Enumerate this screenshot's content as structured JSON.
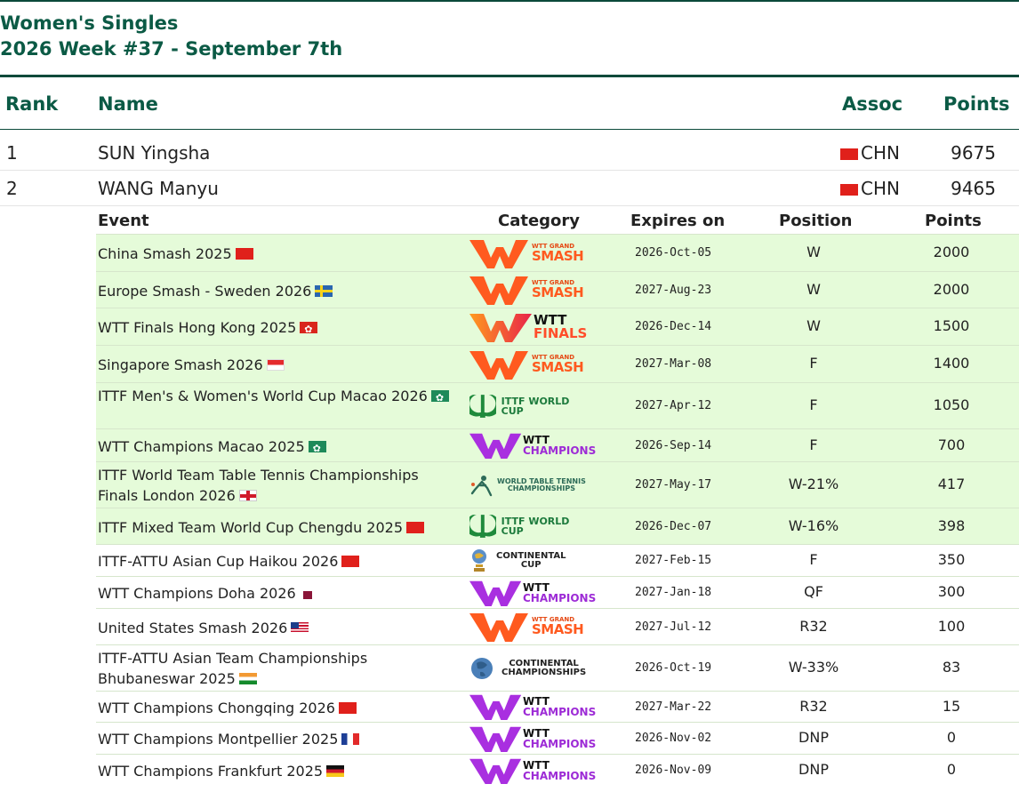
{
  "header": {
    "title": "Women's Singles",
    "subtitle": "2026 Week #37 - September 7th"
  },
  "columns": {
    "rank": "Rank",
    "name": "Name",
    "assoc": "Assoc",
    "points": "Points"
  },
  "players": [
    {
      "rank": "1",
      "name": "SUN Yingsha",
      "assoc": "CHN",
      "points": "9675"
    },
    {
      "rank": "2",
      "name": "WANG Manyu",
      "assoc": "CHN",
      "points": "9465"
    }
  ],
  "event_columns": {
    "event": "Event",
    "category": "Category",
    "expires": "Expires on",
    "position": "Position",
    "points": "Points"
  },
  "events": [
    {
      "name": "China Smash 2025",
      "flag": "cn",
      "category": "wtt-grand-smash",
      "expires": "2026-Oct-05",
      "position": "W",
      "points": "2000",
      "highlight": true
    },
    {
      "name": "Europe Smash - Sweden 2026",
      "flag": "se",
      "category": "wtt-grand-smash",
      "expires": "2027-Aug-23",
      "position": "W",
      "points": "2000",
      "highlight": true
    },
    {
      "name": "WTT Finals Hong Kong 2025",
      "flag": "hk",
      "category": "wtt-finals",
      "expires": "2026-Dec-14",
      "position": "W",
      "points": "1500",
      "highlight": true
    },
    {
      "name": "Singapore Smash 2026",
      "flag": "sg",
      "category": "wtt-grand-smash",
      "expires": "2027-Mar-08",
      "position": "F",
      "points": "1400",
      "highlight": true
    },
    {
      "name": "ITTF Men's & Women's World Cup Macao 2026",
      "flag": "mo",
      "category": "ittf-world-cup",
      "expires": "2027-Apr-12",
      "position": "F",
      "points": "1050",
      "highlight": true
    },
    {
      "name": "WTT Champions Macao 2025",
      "flag": "mo",
      "category": "wtt-champions",
      "expires": "2026-Sep-14",
      "position": "F",
      "points": "700",
      "highlight": true
    },
    {
      "name": "ITTF World Team Table Tennis Championships Finals London 2026",
      "flag": "en",
      "category": "world-table-tennis-championships",
      "expires": "2027-May-17",
      "position": "W-21%",
      "points": "417",
      "highlight": true
    },
    {
      "name": "ITTF Mixed Team World Cup Chengdu 2025",
      "flag": "cn",
      "category": "ittf-world-cup",
      "expires": "2026-Dec-07",
      "position": "W-16%",
      "points": "398",
      "highlight": true
    },
    {
      "name": "ITTF-ATTU Asian Cup Haikou 2026",
      "flag": "cn",
      "category": "continental-cup",
      "expires": "2027-Feb-15",
      "position": "F",
      "points": "350",
      "highlight": false
    },
    {
      "name": "WTT Champions Doha 2026",
      "flag": "qa",
      "category": "wtt-champions",
      "expires": "2027-Jan-18",
      "position": "QF",
      "points": "300",
      "highlight": false
    },
    {
      "name": "United States Smash 2026",
      "flag": "us",
      "category": "wtt-grand-smash",
      "expires": "2027-Jul-12",
      "position": "R32",
      "points": "100",
      "highlight": false
    },
    {
      "name": "ITTF-ATTU Asian Team Championships Bhubaneswar 2025",
      "flag": "in",
      "category": "continental-championships",
      "expires": "2026-Oct-19",
      "position": "W-33%",
      "points": "83",
      "highlight": false
    },
    {
      "name": "WTT Champions Chongqing 2026",
      "flag": "cn",
      "category": "wtt-champions",
      "expires": "2027-Mar-22",
      "position": "R32",
      "points": "15",
      "highlight": false
    },
    {
      "name": "WTT Champions Montpellier 2025",
      "flag": "fr",
      "category": "wtt-champions",
      "expires": "2026-Nov-02",
      "position": "DNP",
      "points": "0",
      "highlight": false
    },
    {
      "name": "WTT Champions Frankfurt 2025",
      "flag": "de",
      "category": "wtt-champions",
      "expires": "2026-Nov-09",
      "position": "DNP",
      "points": "0",
      "highlight": false
    }
  ],
  "logos": {
    "smash_top": "WTT GRAND",
    "smash_main": "SMASH",
    "finals_top": "WTT",
    "finals_main": "FINALS",
    "champions_top": "WTT",
    "champions_main": "CHAMPIONS",
    "world_cup": "ITTF WORLD CUP",
    "wttc_line1": "WORLD TABLE TENNIS",
    "wttc_line2": "CHAMPIONSHIPS",
    "cont_cup_line1": "CONTINENTAL",
    "cont_cup_line2": "CUP",
    "cont_champ_line1": "CONTINENTAL",
    "cont_champ_line2": "CHAMPIONSHIPS"
  },
  "colors": {
    "brand_green": "#0b5a45",
    "highlight_row": "#e5fbd9",
    "smash_orange": "#ff5a1f",
    "champions_purple": "#9d2bd6"
  }
}
